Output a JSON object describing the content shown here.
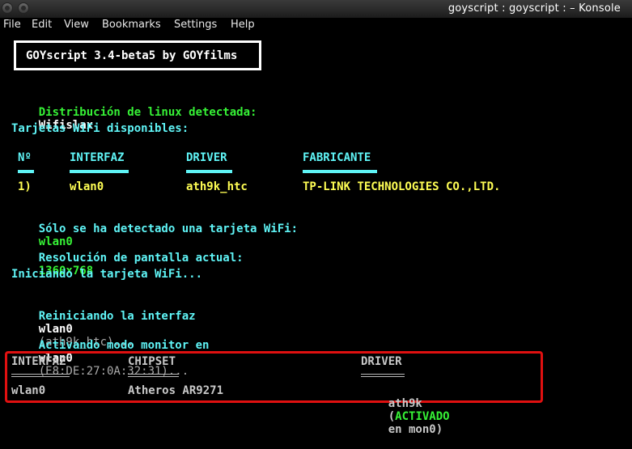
{
  "window": {
    "title": "goyscript : goyscript :  – Konsole"
  },
  "menu": [
    "File",
    "Edit",
    "View",
    "Bookmarks",
    "Settings",
    "Help"
  ],
  "terminal": {
    "header": "GOYscript 3.4-beta5 by GOYfilms",
    "distro_label": "Distribución de linux detectada:",
    "distro_value": "Wifislax",
    "cards_label": "Tarjetas WiFi disponibles:",
    "table1": {
      "headers": [
        "Nº",
        "INTERFAZ",
        "DRIVER",
        "FABRICANTE"
      ],
      "row": [
        "1)",
        "wlan0",
        "ath9k_htc",
        "TP-LINK TECHNOLOGIES CO.,LTD."
      ]
    },
    "detected_label": "Sólo se ha detectado una tarjeta WiFi:",
    "detected_value": "wlan0",
    "resolution_label": "Resolución de pantalla actual:",
    "resolution_value": "1360x768",
    "starting": "Iniciando la tarjeta WiFi...",
    "restart_label": "Reiniciando la interfaz",
    "restart_iface": "wlan0",
    "restart_driver": "(ath9k_htc)...",
    "monitor_label": "Activando modo monitor en",
    "monitor_iface": "wlan0",
    "monitor_mac": "(E8:DE:27:0A:32:31)...",
    "table2": {
      "headers": [
        "INTERFAZ",
        "CHIPSET",
        "DRIVER"
      ],
      "iface": "wlan0",
      "chipset": "Atheros AR9271",
      "driver": "ath9k",
      "paren_open": "(",
      "activated": "ACTIVADO",
      "on_mon": "en mon0)"
    }
  }
}
